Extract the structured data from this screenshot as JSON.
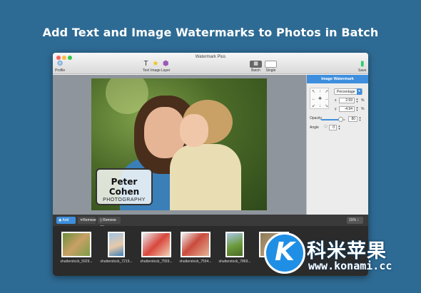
{
  "headline": "Add Text and Image Watermarks to Photos in Batch",
  "window": {
    "title": "Watermark Plus",
    "toolbar": {
      "profile_label": "Profile",
      "text_label": "Text",
      "image_label": "Image",
      "layer_label": "Layer",
      "batch_label": "Batch",
      "single_label": "Single",
      "save_label": "Save"
    }
  },
  "watermark_overlay": {
    "name": "Peter Cohen",
    "subtitle": "PHOTOGRAPHY"
  },
  "panel": {
    "title": "Image Watermark",
    "unit_select": "Percentage",
    "x_label": "x",
    "x_value": "2.69",
    "x_unit": "%",
    "y_label": "y",
    "y_value": "-4.94",
    "y_unit": "%",
    "opacity_label": "Opacity",
    "opacity_value": "80",
    "opacity_level": 0.8,
    "angle_label": "Angle",
    "angle_value": "0"
  },
  "bottom_toolbar": {
    "add_label": "Add",
    "remove_label": "Remove",
    "remove_all_label": "Remove All",
    "zoom": "15%"
  },
  "thumbnails": [
    "shutterstock_5929...",
    "shutterstock_7219...",
    "shutterstock_7559...",
    "shutterstock_7594...",
    "shutterstock_7869...",
    ""
  ],
  "brand": {
    "logo_letter": "K",
    "name": "科米苹果",
    "url": "www.konami.cc"
  },
  "colors": {
    "background": "#2e6b94",
    "accent": "#3d8fdd",
    "brand_blue": "#1f8fe6"
  }
}
